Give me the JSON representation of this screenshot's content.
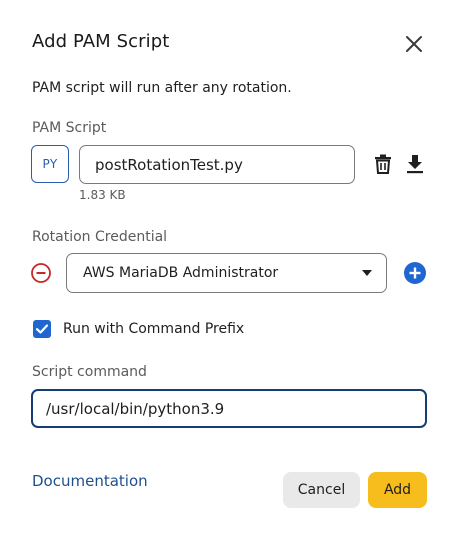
{
  "dialog": {
    "title": "Add PAM Script",
    "description": "PAM script will run after any rotation.",
    "close_icon": "close-icon"
  },
  "pam_script": {
    "label": "PAM Script",
    "badge": "PY",
    "file_name": "postRotationTest.py",
    "file_size": "1.83 KB",
    "delete_icon": "trash-icon",
    "download_icon": "download-icon"
  },
  "rotation_credential": {
    "label": "Rotation Credential",
    "selected": "AWS MariaDB Administrator",
    "remove_icon": "minus-circle-icon",
    "add_icon": "plus-circle-icon"
  },
  "command_prefix": {
    "label": "Run with Command Prefix",
    "checked": true
  },
  "script_command": {
    "label": "Script command",
    "value": "/usr/local/bin/python3.9"
  },
  "footer": {
    "documentation_link": "Documentation",
    "cancel_label": "Cancel",
    "add_label": "Add"
  },
  "colors": {
    "primary_blue": "#1f66d1",
    "add_button_yellow": "#f7bd1c",
    "remove_red": "#c62828",
    "link_blue": "#1f4f8e"
  }
}
